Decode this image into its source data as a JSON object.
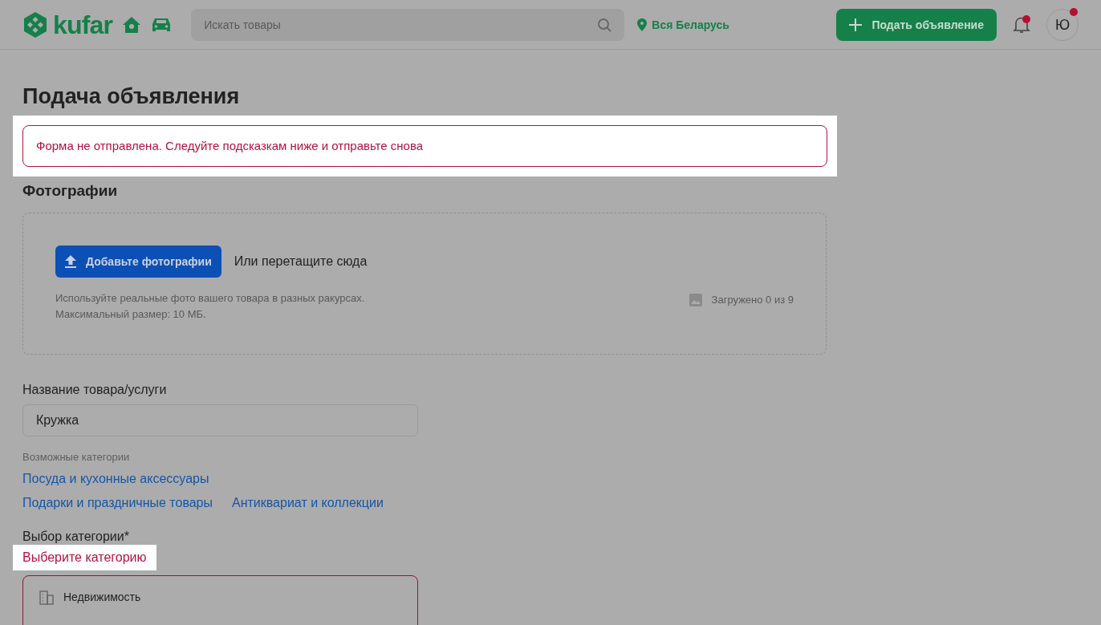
{
  "header": {
    "logo": "kufar",
    "search": {
      "placeholder": "Искать товары"
    },
    "location": "Вся Беларусь",
    "post_button": "Подать объявление",
    "notifications": {
      "unread": true
    },
    "avatar": {
      "letter": "Ю",
      "unread": true
    }
  },
  "page_title": "Подача объявления",
  "error_banner": {
    "text": "Форма не отправлена. Следуйте подсказкам ниже и отправьте снова",
    "highlighted": true
  },
  "photos": {
    "title": "Фотографии",
    "upload_button": "Добавьте фотографии",
    "drag_hint": "Или перетащите сюда",
    "hint_lines": [
      "Используйте реальные фото вашего товара в разных ракурсах.",
      "Максимальный размер: 10 МБ."
    ],
    "counter": "Загружено 0 из 9"
  },
  "title_field": {
    "label": "Название товара/услуги",
    "value": "Кружка"
  },
  "suggested": {
    "label": "Возможные категории",
    "links": [
      [
        "Посуда и кухонные аксессуары"
      ],
      [
        "Подарки и праздничные товары",
        "Антиквариат и коллекции"
      ]
    ]
  },
  "category": {
    "label": "Выбор категории*",
    "error": {
      "text": "Выберите категорию",
      "highlighted": true
    },
    "options": [
      {
        "label": "Недвижимость"
      }
    ]
  }
}
